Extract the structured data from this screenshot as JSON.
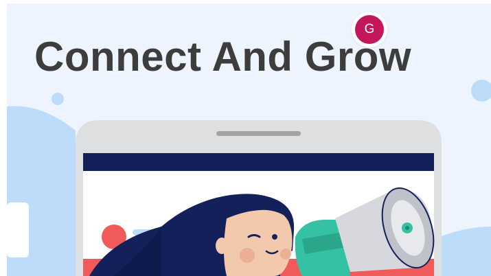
{
  "header": {
    "title": "Connect And Grow"
  },
  "account": {
    "avatar_initial": "G",
    "avatar_color": "#c2185b"
  },
  "colors": {
    "background": "#eef4fd",
    "title_text": "#3d3d3d",
    "phone_frame": "#dedfe1",
    "phone_header_bar": "#13205a",
    "accent_red": "#f05a5a",
    "hair": "#13205a",
    "skin": "#f3c9ae",
    "megaphone_body": "#d6d8de",
    "megaphone_handle": "#35c2a4",
    "blob_blue": "#bcdcfa"
  },
  "illustration": {
    "subject": "woman-with-megaphone",
    "device": "phone-mockup"
  }
}
